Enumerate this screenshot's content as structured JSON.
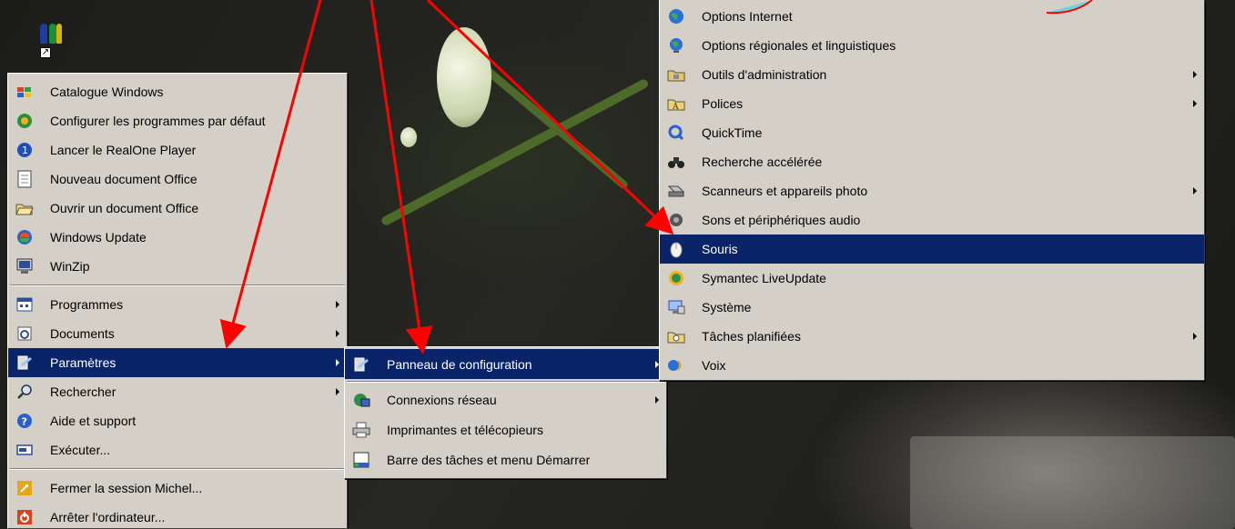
{
  "desktop": {
    "icon_name": "users-icon"
  },
  "start_menu": {
    "top_items": [
      {
        "label": "Catalogue Windows",
        "icon": "windows-catalog-icon"
      },
      {
        "label": "Configurer les programmes par défaut",
        "icon": "default-programs-icon"
      },
      {
        "label": "Lancer le RealOne Player",
        "icon": "realone-icon"
      },
      {
        "label": "Nouveau document Office",
        "icon": "new-document-icon"
      },
      {
        "label": "Ouvrir un document Office",
        "icon": "open-folder-icon"
      },
      {
        "label": "Windows Update",
        "icon": "windows-update-icon"
      },
      {
        "label": "WinZip",
        "icon": "winzip-icon"
      }
    ],
    "mid_items": [
      {
        "label": "Programmes",
        "icon": "programs-icon",
        "submenu": true
      },
      {
        "label": "Documents",
        "icon": "documents-icon",
        "submenu": true
      },
      {
        "label": "Paramètres",
        "icon": "settings-icon",
        "submenu": true,
        "active": true
      },
      {
        "label": "Rechercher",
        "icon": "search-icon",
        "submenu": true
      },
      {
        "label": "Aide et support",
        "icon": "help-icon"
      },
      {
        "label": "Exécuter...",
        "icon": "run-icon"
      }
    ],
    "bottom_items": [
      {
        "label": "Fermer la session Michel...",
        "icon": "logoff-icon"
      },
      {
        "label": "Arrêter l'ordinateur...",
        "icon": "shutdown-icon"
      }
    ]
  },
  "settings_menu": {
    "items": [
      {
        "label": "Panneau de configuration",
        "icon": "control-panel-icon",
        "submenu": true,
        "active": true
      },
      {
        "label": "Connexions réseau",
        "icon": "network-icon",
        "submenu": true
      },
      {
        "label": "Imprimantes et télécopieurs",
        "icon": "printer-icon"
      },
      {
        "label": "Barre des tâches et menu Démarrer",
        "icon": "taskbar-icon"
      }
    ]
  },
  "control_panel_menu": {
    "items": [
      {
        "label": "Options Internet",
        "icon": "globe-icon"
      },
      {
        "label": "Options régionales et linguistiques",
        "icon": "globe-regional-icon"
      },
      {
        "label": "Outils d'administration",
        "icon": "admin-tools-icon",
        "submenu": true
      },
      {
        "label": "Polices",
        "icon": "fonts-folder-icon",
        "submenu": true
      },
      {
        "label": "QuickTime",
        "icon": "quicktime-icon"
      },
      {
        "label": "Recherche accélérée",
        "icon": "binoculars-icon"
      },
      {
        "label": "Scanneurs et appareils photo",
        "icon": "scanner-icon",
        "submenu": true
      },
      {
        "label": "Sons et périphériques audio",
        "icon": "speaker-icon"
      },
      {
        "label": "Souris",
        "icon": "mouse-icon",
        "active": true
      },
      {
        "label": "Symantec LiveUpdate",
        "icon": "liveupdate-icon"
      },
      {
        "label": "Système",
        "icon": "system-icon"
      },
      {
        "label": "Tâches planifiées",
        "icon": "scheduled-tasks-icon",
        "submenu": true
      },
      {
        "label": "Voix",
        "icon": "speech-icon"
      }
    ]
  },
  "colors": {
    "menu_bg": "#d4d0c8",
    "highlight": "#0a246a",
    "annotation_arrow": "#ff0000"
  }
}
